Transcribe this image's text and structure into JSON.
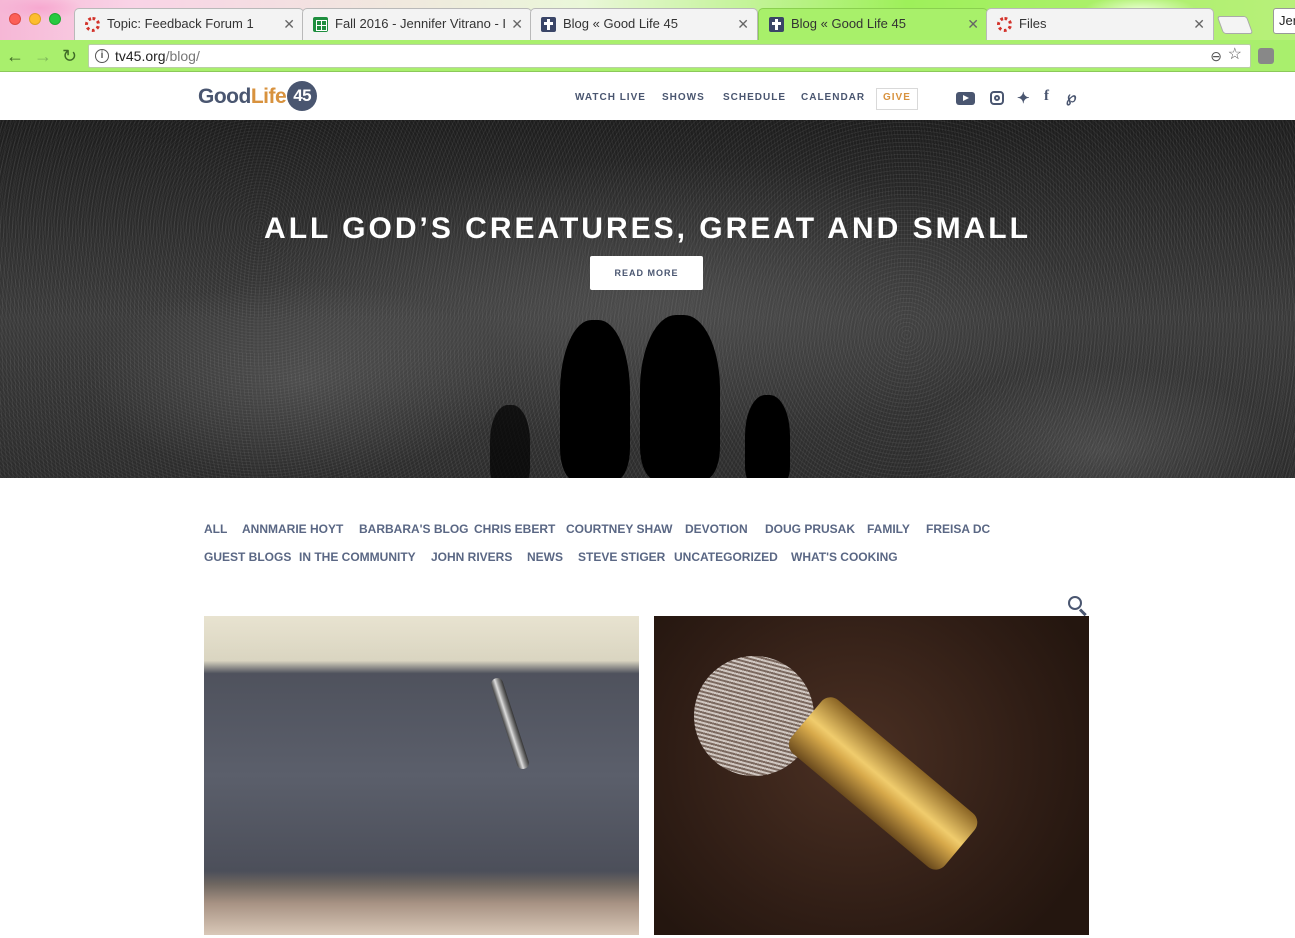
{
  "browser": {
    "tabs": [
      {
        "title": "Topic: Feedback Forum 1",
        "favicon": "ring-icon",
        "active": false
      },
      {
        "title": "Fall 2016 - Jennifer Vitrano - I",
        "favicon": "spreadsheet-icon",
        "active": false
      },
      {
        "title": "Blog « Good Life 45",
        "favicon": "cross-icon",
        "active": false
      },
      {
        "title": "Blog « Good Life 45",
        "favicon": "cross-icon",
        "active": true
      },
      {
        "title": "Files",
        "favicon": "ring-icon",
        "active": false
      }
    ],
    "profile_name": "Jen",
    "url_host": "tv45.org",
    "url_path": "/blog/"
  },
  "site": {
    "logo": {
      "part1": "Good",
      "part2": "Life",
      "part3": "45"
    },
    "nav": [
      "WATCH LIVE",
      "SHOWS",
      "SCHEDULE",
      "CALENDAR",
      "GIVE"
    ],
    "social_icons": [
      "youtube-icon",
      "instagram-icon",
      "twitter-icon",
      "facebook-icon",
      "pinterest-icon"
    ],
    "accent_color": "#d8923e",
    "brand_color": "#4a5670"
  },
  "hero": {
    "title": "ALL GOD’S CREATURES, GREAT AND SMALL",
    "button": "READ MORE"
  },
  "categories": {
    "row1": [
      "ALL",
      "ANNMARIE HOYT",
      "BARBARA'S BLOG",
      "CHRIS EBERT",
      "COURTNEY SHAW",
      "DEVOTION",
      "DOUG PRUSAK",
      "FAMILY",
      "FREISA DC"
    ],
    "row2": [
      "GUEST BLOGS",
      "IN THE COMMUNITY",
      "JOHN RIVERS",
      "NEWS",
      "STEVE STIGER",
      "UNCATEGORIZED",
      "WHAT'S COOKING"
    ]
  }
}
